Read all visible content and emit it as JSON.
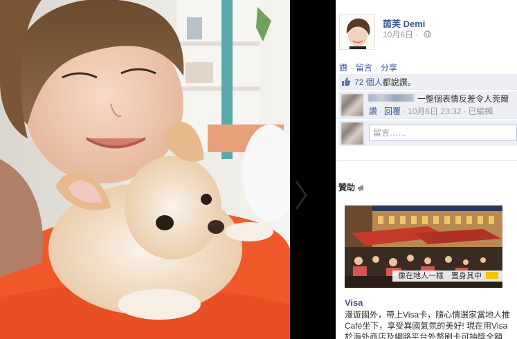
{
  "post": {
    "author_name": "茵芙 Demi",
    "date": "10月6日",
    "privacy_icon": "globe-icon"
  },
  "actions": {
    "like": "讚",
    "comment": "留言",
    "share": "分享",
    "separator": "·"
  },
  "likes": {
    "count_label": "72 個人",
    "rest_label": "都說讚。"
  },
  "comment": {
    "text": "一整個表情反差令人莞爾",
    "like": "讚",
    "reply": "回覆",
    "date": "10月6日 23:32",
    "edited": "已編輯",
    "separator": "·"
  },
  "composer": {
    "placeholder": "留言……"
  },
  "sponsored": {
    "header": "贊助",
    "ad_caption": "像在地人一樣　置身其中",
    "ad_title": "Visa",
    "ad_body_lines": [
      "漫遊國外，帶上Visa卡，隨心情選家當地人推",
      "Café坐下，享受異國氣氛的美好! 現在用Visa",
      "於海外商店及網路平台外幣刷卡可抽獎全額"
    ]
  },
  "colors": {
    "link": "#3b5998",
    "ufi_bg": "#edeff4",
    "stage_bg": "#000000",
    "ad_accent": "#f3c200"
  }
}
